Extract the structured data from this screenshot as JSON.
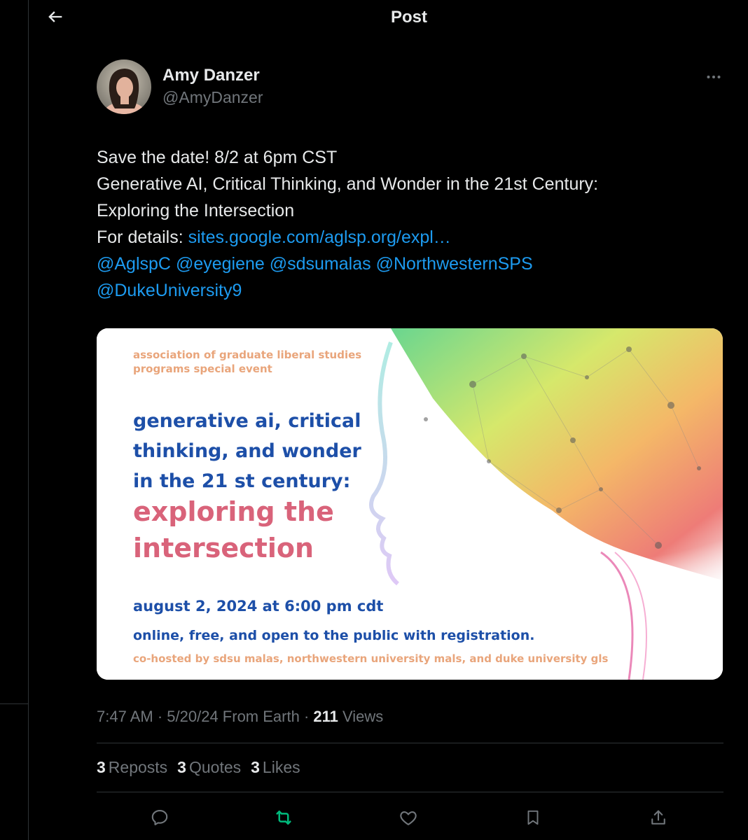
{
  "header": {
    "title": "Post"
  },
  "author": {
    "display_name": "Amy Danzer",
    "handle": "@AmyDanzer"
  },
  "post": {
    "line1": "Save the date! 8/2 at 6pm CST",
    "line2": "Generative AI, Critical Thinking, and Wonder in the 21st Century:",
    "line3": "Exploring the Intersection",
    "details_label": "For details: ",
    "details_link": "sites.google.com/aglsp.org/expl…",
    "mentions_line1": [
      "@AglspC",
      "@eyegiene",
      "@sdsumalas",
      "@NorthwesternSPS"
    ],
    "mentions_line2": [
      "@DukeUniversity9"
    ]
  },
  "media": {
    "org_line1": "association of graduate liberal studies",
    "org_line2": "programs special event",
    "title_line1": "generative ai, critical",
    "title_line2": "thinking, and wonder",
    "title_line3": "in the 21 st century:",
    "subtitle_line1": "exploring the",
    "subtitle_line2": "intersection",
    "date": "august 2, 2024 at 6:00 pm cdt",
    "online": "online, free, and open to the public with registration.",
    "cohost": "co-hosted by sdsu malas, northwestern university mals, and duke university gls"
  },
  "meta": {
    "time": "7:47 AM",
    "sep1": " · ",
    "date": "5/20/24",
    "source": " From Earth",
    "sep2": " · ",
    "views_count": "211",
    "views_label": " Views"
  },
  "stats": {
    "reposts_count": "3",
    "reposts_label": "Reposts",
    "quotes_count": "3",
    "quotes_label": "Quotes",
    "likes_count": "3",
    "likes_label": "Likes"
  },
  "colors": {
    "background": "#000000",
    "text": "#e7e9ea",
    "muted": "#71767b",
    "link": "#1d9bf0",
    "repost_active": "#00ba7c",
    "divider": "#2f3336"
  },
  "icons": [
    "back-arrow-icon",
    "more-icon",
    "reply-icon",
    "repost-icon",
    "like-icon",
    "bookmark-icon",
    "share-icon"
  ]
}
